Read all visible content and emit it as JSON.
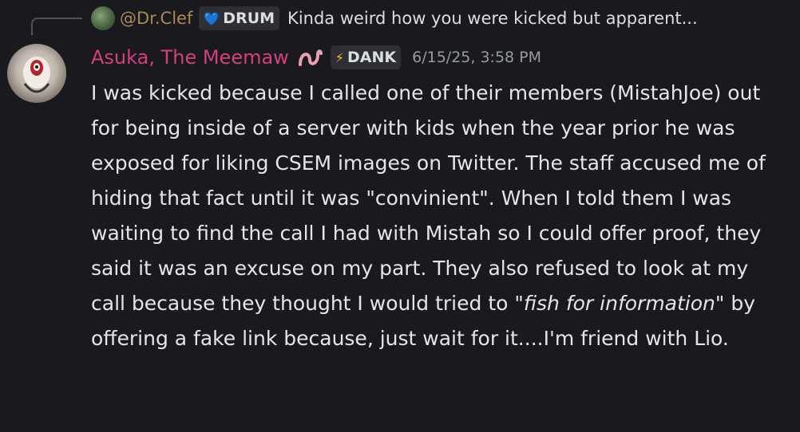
{
  "reply": {
    "username": "@Dr.Clef",
    "tag": "DRUM",
    "tag_icon": "heart-icon",
    "text": "Kinda weird how you were kicked but apparent..."
  },
  "message": {
    "author": "Asuka, The Meemaw",
    "author_icon": "worm-icon",
    "tag": "DANK",
    "tag_icon": "lightning-icon",
    "timestamp": "6/15/25, 3:58 PM",
    "body_part1": "I was kicked because I called one of their members (MistahJoe) out for being inside of a server with kids when the year prior he was exposed for liking CSEM images on Twitter. The staff accused me of hiding that fact until it was \"convinient\". When I told them I was waiting to find the call I had with Mistah so I could offer proof, they said it was an excuse on my part. They also refused to look at my call because they thought I would tried to ",
    "body_emphasis": "\"fish for information\"",
    "body_part2": " by offering a fake link because, just wait for it....I'm friend with Lio."
  },
  "colors": {
    "background": "#1a1a1e",
    "author": "#d0417d",
    "reply_name": "#a78a4d",
    "text": "#e3e5e8",
    "timestamp": "#949ba4"
  }
}
